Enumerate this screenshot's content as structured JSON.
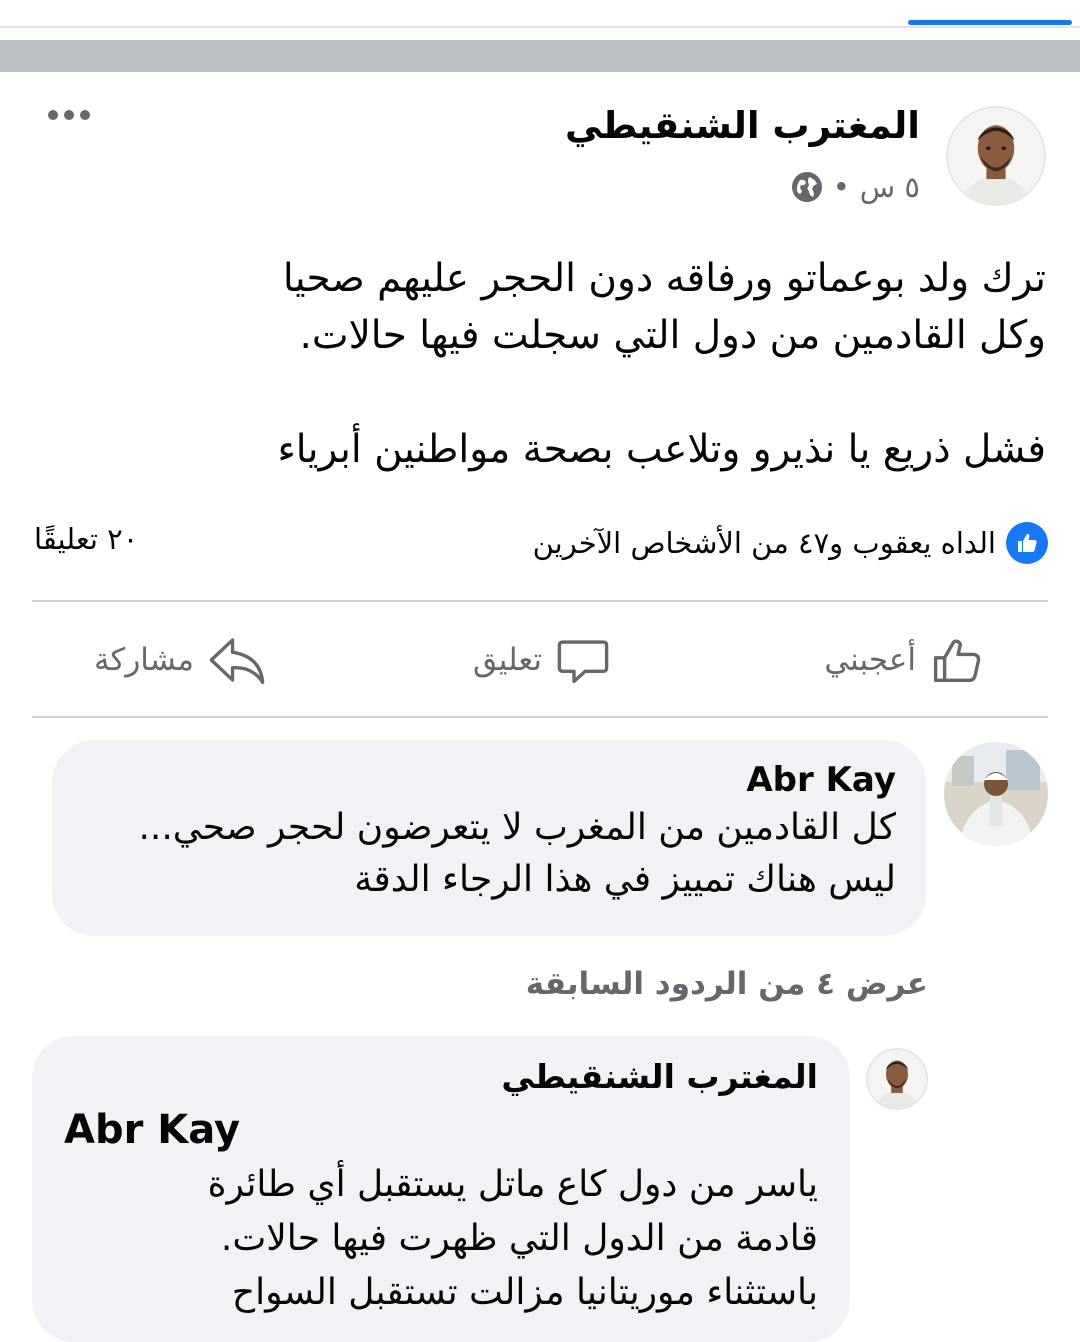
{
  "post": {
    "author": "المغترب الشنقيطي",
    "time": "٥ س",
    "dot": "•",
    "text_lines": [
      "ترك ولد بوعماتو ورفاقه  دون الحجر عليهم صحيا",
      "وكل  القادمين  من دول التي سجلت فيها حالات.",
      "فشل ذريع يا نذيرو وتلاعب  بصحة  مواطنين  أبرياء"
    ],
    "reactions_text": "الداه يعقوب و٤٧ من الأشخاص الآخرين",
    "comments_count": "٢٠ تعليقًا"
  },
  "actions": {
    "like": "أعجبني",
    "comment": "تعليق",
    "share": "مشاركة"
  },
  "comment1": {
    "name": "Abr Kay",
    "lines": [
      "كل القادمين من المغرب لا يتعرضون لحجر صحي...",
      "ليس هناك تمييز في هذا الرجاء الدقة"
    ]
  },
  "previous_replies": "عرض ٤ من الردود السابقة",
  "reply": {
    "name": "المغترب الشنقيطي",
    "mention": "Abr Kay",
    "lines": [
      "ياسر من دول كاع ماتل يستقبل  أي  طائرة",
      "قادمة من الدول التي ظهرت  فيها حالات.",
      "باستثناء  موريتانيا  مزالت تستقبل السواح"
    ]
  },
  "colors": {
    "accent": "#1877f2",
    "bubble": "#f0f2f5",
    "secondary_text": "#65676b",
    "separator": "#bcc0c4"
  },
  "icons": {
    "audience": "globe-icon",
    "options": "more-options-icon",
    "reaction": "like-reaction-icon",
    "like": "thumbs-up-icon",
    "comment": "comment-bubble-icon",
    "share": "share-arrow-icon"
  }
}
